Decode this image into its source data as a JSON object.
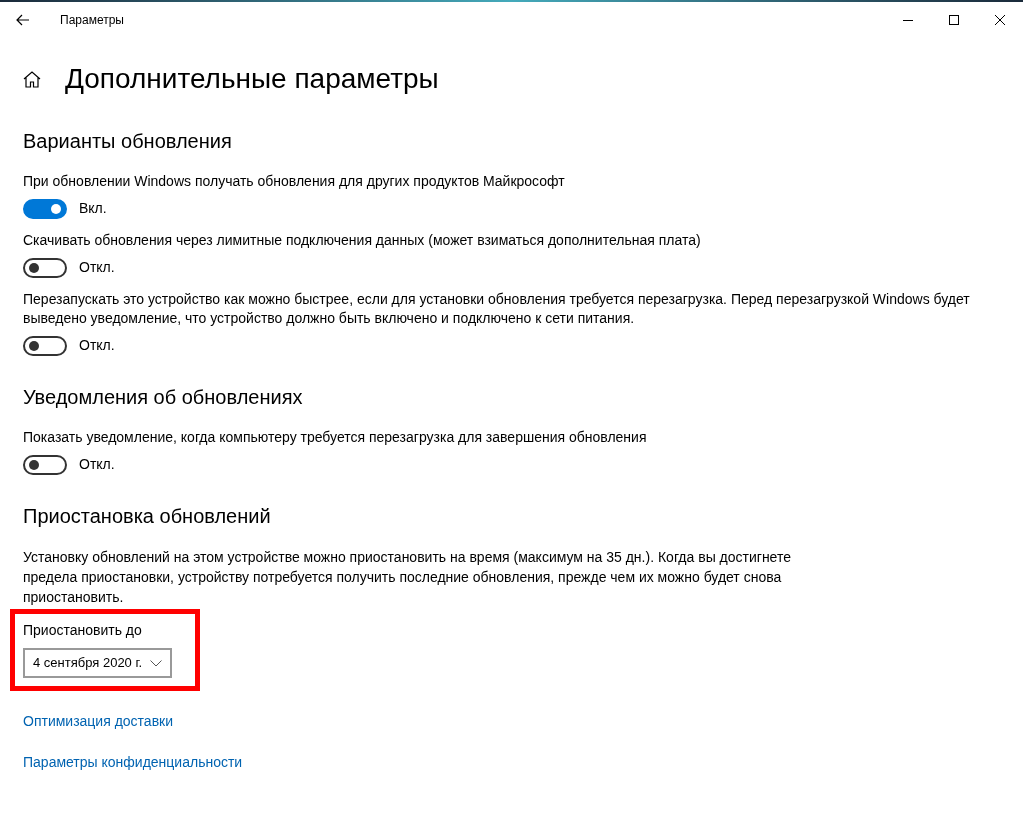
{
  "window": {
    "title": "Параметры"
  },
  "page_title": "Дополнительные параметры",
  "sections": [
    {
      "title": "Варианты обновления",
      "settings": [
        {
          "description": "При обновлении Windows получать обновления для других продуктов Майкрософт",
          "on": true,
          "state_label": "Вкл."
        },
        {
          "description": "Скачивать обновления через лимитные подключения данных (может взиматься дополнительная плата)",
          "on": false,
          "state_label": "Откл."
        },
        {
          "description": "Перезапускать это устройство как можно быстрее, если для установки обновления требуется перезагрузка. Перед перезагрузкой Windows будет выведено уведомление, что устройство должно быть включено и подключено к сети питания.",
          "on": false,
          "state_label": "Откл."
        }
      ]
    },
    {
      "title": "Уведомления об обновлениях",
      "settings": [
        {
          "description": "Показать уведомление, когда компьютеру требуется перезагрузка для завершения обновления",
          "on": false,
          "state_label": "Откл."
        }
      ]
    }
  ],
  "pause": {
    "title": "Приостановка обновлений",
    "description": "Установку обновлений на этом устройстве можно приостановить на время (максимум на 35 дн.). Когда вы достигнете предела приостановки, устройству потребуется получить последние обновления, прежде чем их можно будет снова приостановить.",
    "dropdown_label": "Приостановить до",
    "dropdown_value": "4 сентября 2020 г."
  },
  "links": [
    "Оптимизация доставки",
    "Параметры конфиденциальности"
  ]
}
